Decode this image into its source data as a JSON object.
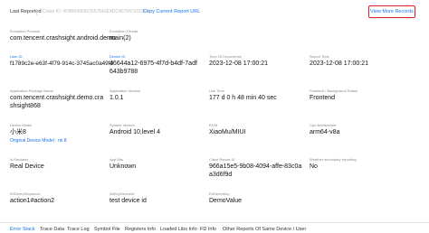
{
  "header": {
    "status": "Last Reported",
    "crash_id": "Crash ID: #F8B6495557657640E4DC4078471012F6",
    "copy_url": "Copy Current Report URL",
    "view_more": "View More Records"
  },
  "fields": [
    {
      "label": "Exception Process",
      "value": "com.tencent.crashsight.android.demo"
    },
    {
      "label": "Exception Thread",
      "value": "main(2)"
    },
    {
      "label": "User ID",
      "value": "f1789c2e-e63f-4f79-914c-3745ac0a49fd"
    },
    {
      "label": "Device ID",
      "value": "46644a12-6975-4f7d-b4df-7adf643b9788"
    },
    {
      "label": "Time Of Occurrence",
      "value": "2023-12-08 17:00:21"
    },
    {
      "label": "Report Time",
      "value": "2023-12-08 17:00:21"
    },
    {
      "label": "Application Package Name",
      "value": "com.tencent.crashsight.demo.crashsight868"
    },
    {
      "label": "Application Version",
      "value": "1.0.1"
    },
    {
      "label": "Use Time",
      "value": "177 d 0 h 48 min 40 sec"
    },
    {
      "label": "Frontend / Background Status",
      "value": "Frontend"
    },
    {
      "label": "Device Model",
      "value": "小米8",
      "sub": "Original Device Model : mi 8"
    },
    {
      "label": "System Version",
      "value": "Android 10,level 4"
    },
    {
      "label": "ROM",
      "value": "XiaoMu/MIUI"
    },
    {
      "label": "Cpu Architecture",
      "value": "arm64-v8a"
    },
    {
      "label": "Is Emulator",
      "value": "Real Device"
    },
    {
      "label": "App Bits",
      "value": "Unknown"
    },
    {
      "label": "Client Report ID",
      "value": "966a15e5-9b08-4094-affe-83c0aa3d6f9d"
    },
    {
      "label": "Whether secondary reporting",
      "value": "No"
    },
    {
      "label": "E#DemoSequence",
      "value": "action1#action2"
    },
    {
      "label": "A#KeyDeviceId",
      "value": "test device id"
    },
    {
      "label": "E#DemoKey",
      "value": "DemoValue"
    }
  ],
  "tabs": [
    {
      "label": "Error Stack",
      "active": true
    },
    {
      "label": "Trace Data"
    },
    {
      "label": "Trace Log"
    },
    {
      "label": "Symbol File"
    },
    {
      "label": "Registers Info"
    },
    {
      "label": "Loaded Libs Info"
    },
    {
      "label": "FD Info"
    },
    {
      "label": "Other Reports Of Same Device / User"
    }
  ],
  "colors": {
    "link": "#1a73e8",
    "highlight_border": "#e02020"
  }
}
